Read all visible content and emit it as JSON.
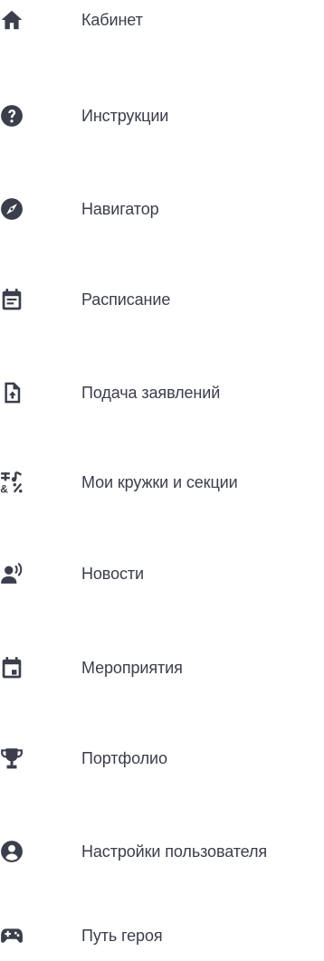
{
  "colors": {
    "icon": "#3b3e4b",
    "text": "#3b3e4b",
    "background": "#ffffff"
  },
  "nav": {
    "items": [
      {
        "label": "Кабинет",
        "icon": "home-icon"
      },
      {
        "label": "Инструкции",
        "icon": "help-circle-icon"
      },
      {
        "label": "Навигатор",
        "icon": "compass-icon"
      },
      {
        "label": "Расписание",
        "icon": "calendar-notes-icon"
      },
      {
        "label": "Подача заявлений",
        "icon": "file-upload-icon"
      },
      {
        "label": "Мои кружки и секции",
        "icon": "symbols-icon"
      },
      {
        "label": "Новости",
        "icon": "person-broadcast-icon"
      },
      {
        "label": "Мероприятия",
        "icon": "calendar-event-icon"
      },
      {
        "label": "Портфолио",
        "icon": "trophy-icon"
      },
      {
        "label": "Настройки пользователя",
        "icon": "account-circle-icon"
      },
      {
        "label": "Путь героя",
        "icon": "gamepad-icon"
      }
    ]
  }
}
